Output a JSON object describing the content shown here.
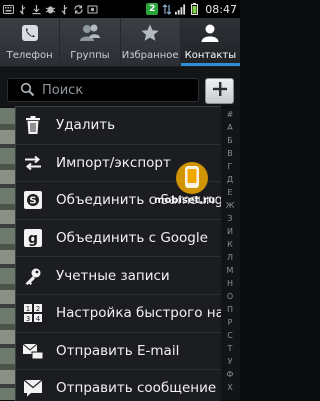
{
  "status_bar": {
    "badge": "2",
    "time": "08:47"
  },
  "tabs": [
    {
      "label": "Телефон",
      "icon": "phone-icon",
      "active": false
    },
    {
      "label": "Группы",
      "icon": "group-icon",
      "active": false
    },
    {
      "label": "Избранное",
      "icon": "star-icon",
      "active": false
    },
    {
      "label": "Контакты",
      "icon": "person-icon",
      "active": true
    }
  ],
  "search": {
    "placeholder": "Поиск",
    "value": ""
  },
  "index_letters": [
    "#",
    "А",
    "Б",
    "В",
    "Г",
    "Д",
    "Е",
    "Ж",
    "З",
    "И",
    "К",
    "Л",
    "М",
    "Н",
    "О",
    "П",
    "Р",
    "С",
    "Т",
    "У",
    "Ф",
    "Х"
  ],
  "menu": {
    "items": [
      {
        "label": "Удалить",
        "icon": "trash-icon"
      },
      {
        "label": "Импорт/экспорт",
        "icon": "import-export-icon"
      },
      {
        "label": "Объединить с Samsung",
        "icon": "samsung-merge-icon"
      },
      {
        "label": "Объединить с Google",
        "icon": "google-merge-icon"
      },
      {
        "label": "Учетные записи",
        "icon": "key-icon"
      },
      {
        "label": "Настройка быстрого набора",
        "icon": "speed-dial-icon"
      },
      {
        "label": "Отправить E-mail",
        "icon": "email-icon"
      },
      {
        "label": "Отправить сообщение",
        "icon": "message-icon"
      }
    ]
  },
  "watermark": {
    "text": "mobiset.ru"
  },
  "colors": {
    "accent": "#2f8fd6",
    "status_badge": "#2aa63a",
    "watermark_logo": "#f0a800"
  }
}
